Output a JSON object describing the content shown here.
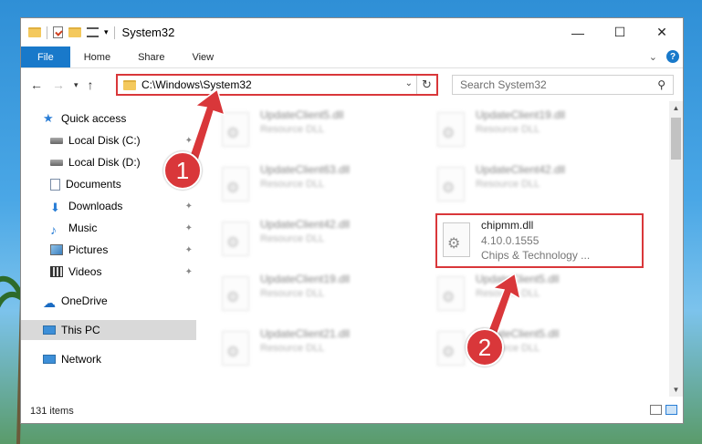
{
  "window": {
    "title": "System32",
    "caption": {
      "minimize": "—",
      "maximize": "☐",
      "close": "✕"
    }
  },
  "ribbon": {
    "tabs": [
      "File",
      "Home",
      "Share",
      "View"
    ],
    "expand_icon": "chevron-down-icon",
    "help": "?"
  },
  "address": {
    "path": "C:\\Windows\\System32",
    "search_placeholder": "Search System32"
  },
  "nav_pane": {
    "items": [
      {
        "label": "Quick access",
        "icon": "star-icon",
        "pinned": false
      },
      {
        "label": "Local Disk (C:)",
        "icon": "disk-icon",
        "pinned": true
      },
      {
        "label": "Local Disk (D:)",
        "icon": "disk-icon",
        "pinned": false
      },
      {
        "label": "Documents",
        "icon": "document-icon",
        "pinned": true
      },
      {
        "label": "Downloads",
        "icon": "download-icon",
        "pinned": true
      },
      {
        "label": "Music",
        "icon": "music-icon",
        "pinned": true
      },
      {
        "label": "Pictures",
        "icon": "pictures-icon",
        "pinned": true
      },
      {
        "label": "Videos",
        "icon": "videos-icon",
        "pinned": true
      },
      {
        "label": "OneDrive",
        "icon": "cloud-icon",
        "pinned": false
      },
      {
        "label": "This PC",
        "icon": "pc-icon",
        "pinned": false,
        "selected": true
      },
      {
        "label": "Network",
        "icon": "network-icon",
        "pinned": false
      }
    ]
  },
  "files": {
    "left_column": [
      {
        "name": "UpdateClient5.dll",
        "desc": "Resource DLL"
      },
      {
        "name": "UpdateClient63.dll",
        "desc": "Resource DLL"
      },
      {
        "name": "UpdateClient42.dll",
        "desc": "Resource DLL"
      },
      {
        "name": "UpdateClient19.dll",
        "desc": "Resource DLL"
      },
      {
        "name": "UpdateClient21.dll",
        "desc": "Resource DLL"
      }
    ],
    "right_column": [
      {
        "name": "UpdateClient19.dll",
        "desc": "Resource DLL"
      },
      {
        "name": "UpdateClient42.dll",
        "desc": "Resource DLL"
      },
      {
        "name": "UpdateClient5.dll",
        "desc": "Resource DLL"
      },
      {
        "name": "UpdateClient5.dll",
        "desc": "Resource DLL"
      }
    ],
    "highlighted": {
      "name": "chipmm.dll",
      "version": "4.10.0.1555",
      "company": "Chips & Technology ..."
    }
  },
  "status": {
    "count": "131 items"
  },
  "annotations": {
    "step1": "1",
    "step2": "2",
    "color": "#d9373a"
  }
}
